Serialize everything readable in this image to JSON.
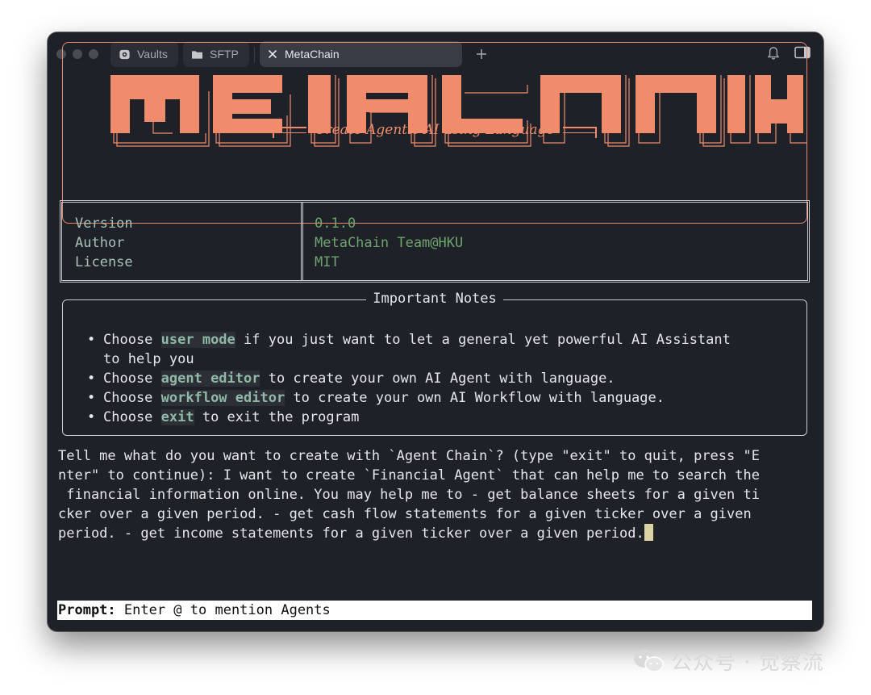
{
  "tabs": [
    {
      "label": "Vaults",
      "icon": "vault-icon"
    },
    {
      "label": "SFTP",
      "icon": "folder-icon"
    },
    {
      "label": "MetaChain",
      "icon": "close-icon",
      "active": true
    }
  ],
  "banner": {
    "logo_text": "METACHAIN",
    "tagline": "Create Agentic AI using Language",
    "accent_color": "#f08c6b"
  },
  "info": {
    "keys": [
      "Version",
      "Author",
      "License"
    ],
    "values": [
      "0.1.0",
      "MetaChain Team@HKU",
      "MIT"
    ]
  },
  "notes": {
    "title": "Important Notes",
    "items": [
      {
        "pre": "Choose ",
        "hl": "user mode",
        "post": " if you just want to let a general yet powerful AI Assistant",
        "post2": "to help you"
      },
      {
        "pre": "Choose ",
        "hl": "agent editor",
        "post": " to create your own AI Agent with language."
      },
      {
        "pre": "Choose ",
        "hl": "workflow editor",
        "post": " to create your own AI Workflow with language."
      },
      {
        "pre": "Choose ",
        "hl": "exit",
        "post": " to exit the program"
      }
    ]
  },
  "output_lines": [
    "Tell me what do you want to create with `Agent Chain`? (type \"exit\" to quit, press \"E",
    "nter\" to continue): I want to create `Financial Agent` that can help me to search the",
    " financial information online. You may help me to - get balance sheets for a given ti",
    "cker over a given period. - get cash flow statements for a given ticker over a given",
    "period. - get income statements for a given ticker over a given period."
  ],
  "prompt": {
    "label": "Prompt:",
    "placeholder": " Enter @ to mention Agents"
  },
  "watermark": "公众号 · 觉察流"
}
